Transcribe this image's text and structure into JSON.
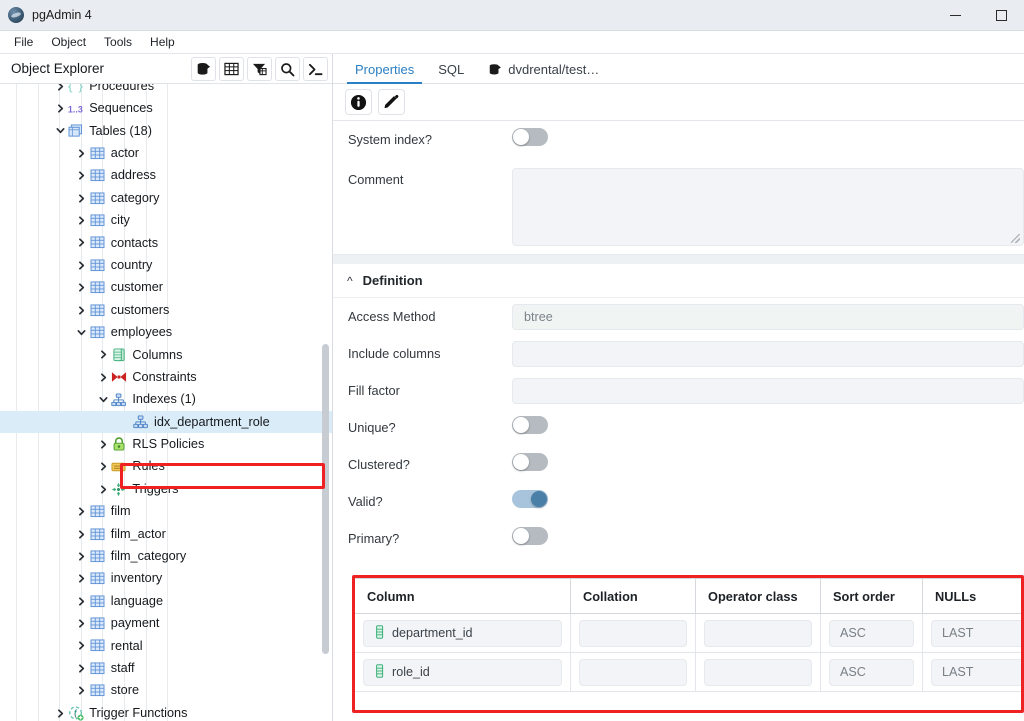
{
  "window": {
    "title": "pgAdmin 4",
    "app_icon": "pgadmin-logo-icon",
    "controls": {
      "minimize": "minimize-icon",
      "maximize": "maximize-icon"
    }
  },
  "menubar": {
    "items": [
      "File",
      "Object",
      "Tools",
      "Help"
    ]
  },
  "object_explorer": {
    "title": "Object Explorer",
    "toolbar": [
      {
        "name": "server-icon"
      },
      {
        "name": "table-grid-icon"
      },
      {
        "name": "filter-icon"
      },
      {
        "name": "search-icon"
      },
      {
        "name": "query-tool-icon"
      }
    ],
    "tree": [
      {
        "label": "Procedures",
        "indent": 2,
        "twist": "collapsed",
        "icon": "procedure-icon",
        "selected": false
      },
      {
        "label": "Sequences",
        "indent": 2,
        "twist": "collapsed",
        "icon": "sequence-icon",
        "selected": false
      },
      {
        "label": "Tables (18)",
        "indent": 2,
        "twist": "expanded",
        "icon": "tables-icon",
        "selected": false
      },
      {
        "label": "actor",
        "indent": 3,
        "twist": "collapsed",
        "icon": "table-icon",
        "selected": false
      },
      {
        "label": "address",
        "indent": 3,
        "twist": "collapsed",
        "icon": "table-icon",
        "selected": false
      },
      {
        "label": "category",
        "indent": 3,
        "twist": "collapsed",
        "icon": "table-icon",
        "selected": false
      },
      {
        "label": "city",
        "indent": 3,
        "twist": "collapsed",
        "icon": "table-icon",
        "selected": false
      },
      {
        "label": "contacts",
        "indent": 3,
        "twist": "collapsed",
        "icon": "table-icon",
        "selected": false
      },
      {
        "label": "country",
        "indent": 3,
        "twist": "collapsed",
        "icon": "table-icon",
        "selected": false
      },
      {
        "label": "customer",
        "indent": 3,
        "twist": "collapsed",
        "icon": "table-icon",
        "selected": false
      },
      {
        "label": "customers",
        "indent": 3,
        "twist": "collapsed",
        "icon": "table-icon",
        "selected": false
      },
      {
        "label": "employees",
        "indent": 3,
        "twist": "expanded",
        "icon": "table-icon",
        "selected": false
      },
      {
        "label": "Columns",
        "indent": 4,
        "twist": "collapsed",
        "icon": "columns-icon",
        "selected": false
      },
      {
        "label": "Constraints",
        "indent": 4,
        "twist": "collapsed",
        "icon": "constraints-icon",
        "selected": false
      },
      {
        "label": "Indexes (1)",
        "indent": 4,
        "twist": "expanded",
        "icon": "indexes-icon",
        "selected": false
      },
      {
        "label": "idx_department_role",
        "indent": 5,
        "twist": "none",
        "icon": "index-icon",
        "selected": true
      },
      {
        "label": "RLS Policies",
        "indent": 4,
        "twist": "collapsed",
        "icon": "rls-policy-icon",
        "selected": false
      },
      {
        "label": "Rules",
        "indent": 4,
        "twist": "collapsed",
        "icon": "rules-icon",
        "selected": false
      },
      {
        "label": "Triggers",
        "indent": 4,
        "twist": "collapsed",
        "icon": "triggers-icon",
        "selected": false
      },
      {
        "label": "film",
        "indent": 3,
        "twist": "collapsed",
        "icon": "table-icon",
        "selected": false
      },
      {
        "label": "film_actor",
        "indent": 3,
        "twist": "collapsed",
        "icon": "table-icon",
        "selected": false
      },
      {
        "label": "film_category",
        "indent": 3,
        "twist": "collapsed",
        "icon": "table-icon",
        "selected": false
      },
      {
        "label": "inventory",
        "indent": 3,
        "twist": "collapsed",
        "icon": "table-icon",
        "selected": false
      },
      {
        "label": "language",
        "indent": 3,
        "twist": "collapsed",
        "icon": "table-icon",
        "selected": false
      },
      {
        "label": "payment",
        "indent": 3,
        "twist": "collapsed",
        "icon": "table-icon",
        "selected": false
      },
      {
        "label": "rental",
        "indent": 3,
        "twist": "collapsed",
        "icon": "table-icon",
        "selected": false
      },
      {
        "label": "staff",
        "indent": 3,
        "twist": "collapsed",
        "icon": "table-icon",
        "selected": false
      },
      {
        "label": "store",
        "indent": 3,
        "twist": "collapsed",
        "icon": "table-icon",
        "selected": false
      },
      {
        "label": "Trigger Functions",
        "indent": 2,
        "twist": "collapsed",
        "icon": "trigger-function-icon",
        "selected": false
      }
    ]
  },
  "content": {
    "tabs": [
      {
        "label": "Properties",
        "active": true,
        "icon": null
      },
      {
        "label": "SQL",
        "active": false,
        "icon": null
      },
      {
        "label": "dvdrental/test…",
        "active": false,
        "icon": "database-icon"
      }
    ],
    "subtoolbar": [
      {
        "name": "info-icon"
      },
      {
        "name": "edit-pencil-icon"
      }
    ],
    "properties": {
      "system_index": {
        "label": "System index?",
        "value": "off"
      },
      "comment": {
        "label": "Comment",
        "value": ""
      },
      "definition_section": {
        "label": "Definition",
        "collapsed": false
      },
      "access_method": {
        "label": "Access Method",
        "value": "btree"
      },
      "include_columns": {
        "label": "Include columns",
        "value": ""
      },
      "fill_factor": {
        "label": "Fill factor",
        "value": ""
      },
      "unique": {
        "label": "Unique?",
        "value": "off"
      },
      "clustered": {
        "label": "Clustered?",
        "value": "off"
      },
      "valid": {
        "label": "Valid?",
        "value": "on"
      },
      "primary": {
        "label": "Primary?",
        "value": "off"
      }
    },
    "columns_grid": {
      "headers": [
        "Column",
        "Collation",
        "Operator class",
        "Sort order",
        "NULLs"
      ],
      "rows": [
        {
          "column": "department_id",
          "collation": "",
          "operator_class": "",
          "sort_order": "ASC",
          "nulls": "LAST"
        },
        {
          "column": "role_id",
          "collation": "",
          "operator_class": "",
          "sort_order": "ASC",
          "nulls": "LAST"
        }
      ]
    }
  },
  "annotations": {
    "highlight_color": "#ee2222",
    "boxes": [
      "selected-index-node",
      "index-columns-grid"
    ]
  },
  "colors": {
    "accent": "#2b7fc4",
    "selection": "#d9ecf7",
    "toggle_on": "#4a7fa8",
    "field_bg": "#f2f4f7"
  }
}
